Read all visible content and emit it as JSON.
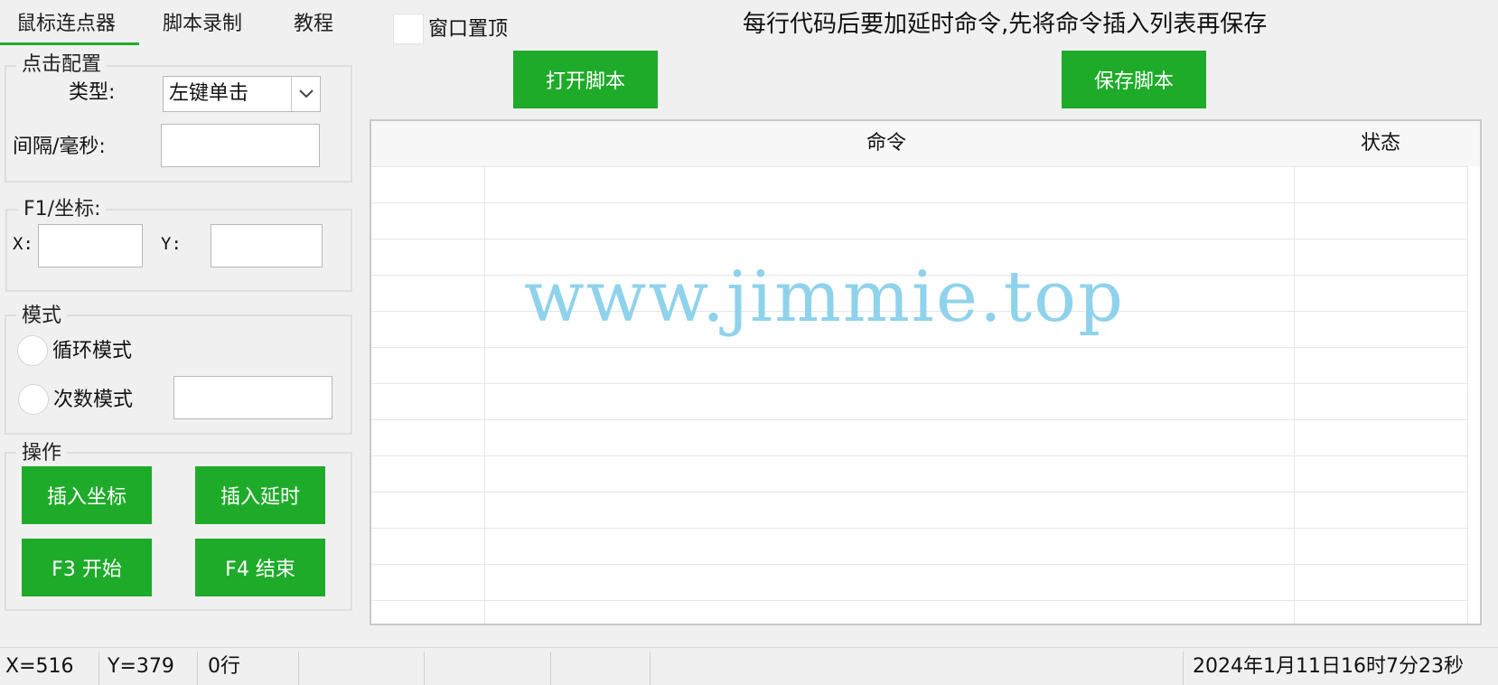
{
  "tabs": [
    {
      "label": "鼠标连点器",
      "active": true
    },
    {
      "label": "脚本录制",
      "active": false
    },
    {
      "label": "教程",
      "active": false
    }
  ],
  "topmost_label": "窗口置顶",
  "hint": "每行代码后要加延时命令,先将命令插入列表再保存",
  "toolbar": {
    "open_label": "打开脚本",
    "save_label": "保存脚本"
  },
  "click_config": {
    "title": "点击配置",
    "type_label": "类型:",
    "type_value": "左键单击",
    "interval_label": "间隔/毫秒:",
    "interval_value": ""
  },
  "coords": {
    "title": "F1/坐标:",
    "x_label": "X:",
    "y_label": "Y:",
    "x_value": "",
    "y_value": ""
  },
  "mode": {
    "title": "模式",
    "loop_label": "循环模式",
    "count_label": "次数模式",
    "count_value": ""
  },
  "actions": {
    "title": "操作",
    "insert_coord": "插入坐标",
    "insert_delay": "插入延时",
    "start": "F3 开始",
    "stop": "F4 结束"
  },
  "table": {
    "columns": [
      "命令",
      "状态"
    ],
    "rows": []
  },
  "watermark": "www.jimmie.top",
  "status": {
    "x": "X=516",
    "y": "Y=379",
    "rows": "0行",
    "datetime": "2024年1月11日16时7分23秒"
  },
  "colors": {
    "accent": "#1fab2a",
    "watermark": "#8fd2ec"
  }
}
